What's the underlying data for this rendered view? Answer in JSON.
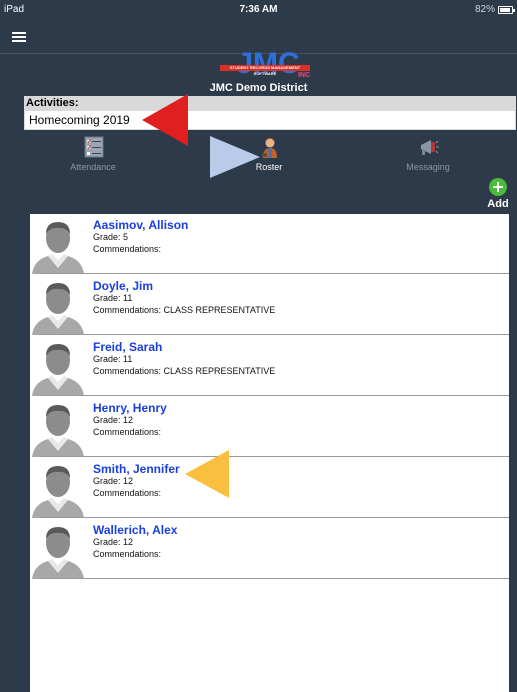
{
  "statusbar": {
    "device": "iPad",
    "time": "7:36 AM",
    "battery": "82%"
  },
  "header": {
    "brand": "JMC",
    "brand_strip": "STUDENT RECORDS MANAGEMENT SOFTWARE",
    "brand_suffix": "INC",
    "district": "JMC Demo District"
  },
  "activities": {
    "label": "Activities:",
    "value": "Homecoming 2019"
  },
  "tabs": [
    {
      "label": "Attendance",
      "icon": "checklist-icon"
    },
    {
      "label": "Roster",
      "icon": "student-icon"
    },
    {
      "label": "Messaging",
      "icon": "megaphone-icon"
    }
  ],
  "add": {
    "label": "Add",
    "icon": "plus-circle-icon"
  },
  "students": [
    {
      "name": "Aasimov, Allison",
      "grade": "Grade: 5",
      "commendations": "Commendations:"
    },
    {
      "name": "Doyle, Jim",
      "grade": "Grade: 11",
      "commendations": "Commendations: CLASS REPRESENTATIVE"
    },
    {
      "name": "Freid, Sarah",
      "grade": "Grade: 11",
      "commendations": "Commendations: CLASS REPRESENTATIVE"
    },
    {
      "name": "Henry, Henry",
      "grade": "Grade: 12",
      "commendations": "Commendations:"
    },
    {
      "name": "Smith, Jennifer",
      "grade": "Grade: 12",
      "commendations": "Commendations:"
    },
    {
      "name": "Wallerich, Alex",
      "grade": "Grade: 12",
      "commendations": "Commendations:"
    }
  ],
  "colors": {
    "background": "#2d3a4a",
    "name_link": "#1a3fdc",
    "add_green": "#4cba3a",
    "arrow_red": "#e02020",
    "arrow_blue": "#b8cbe8",
    "arrow_orange": "#fbbf40"
  }
}
